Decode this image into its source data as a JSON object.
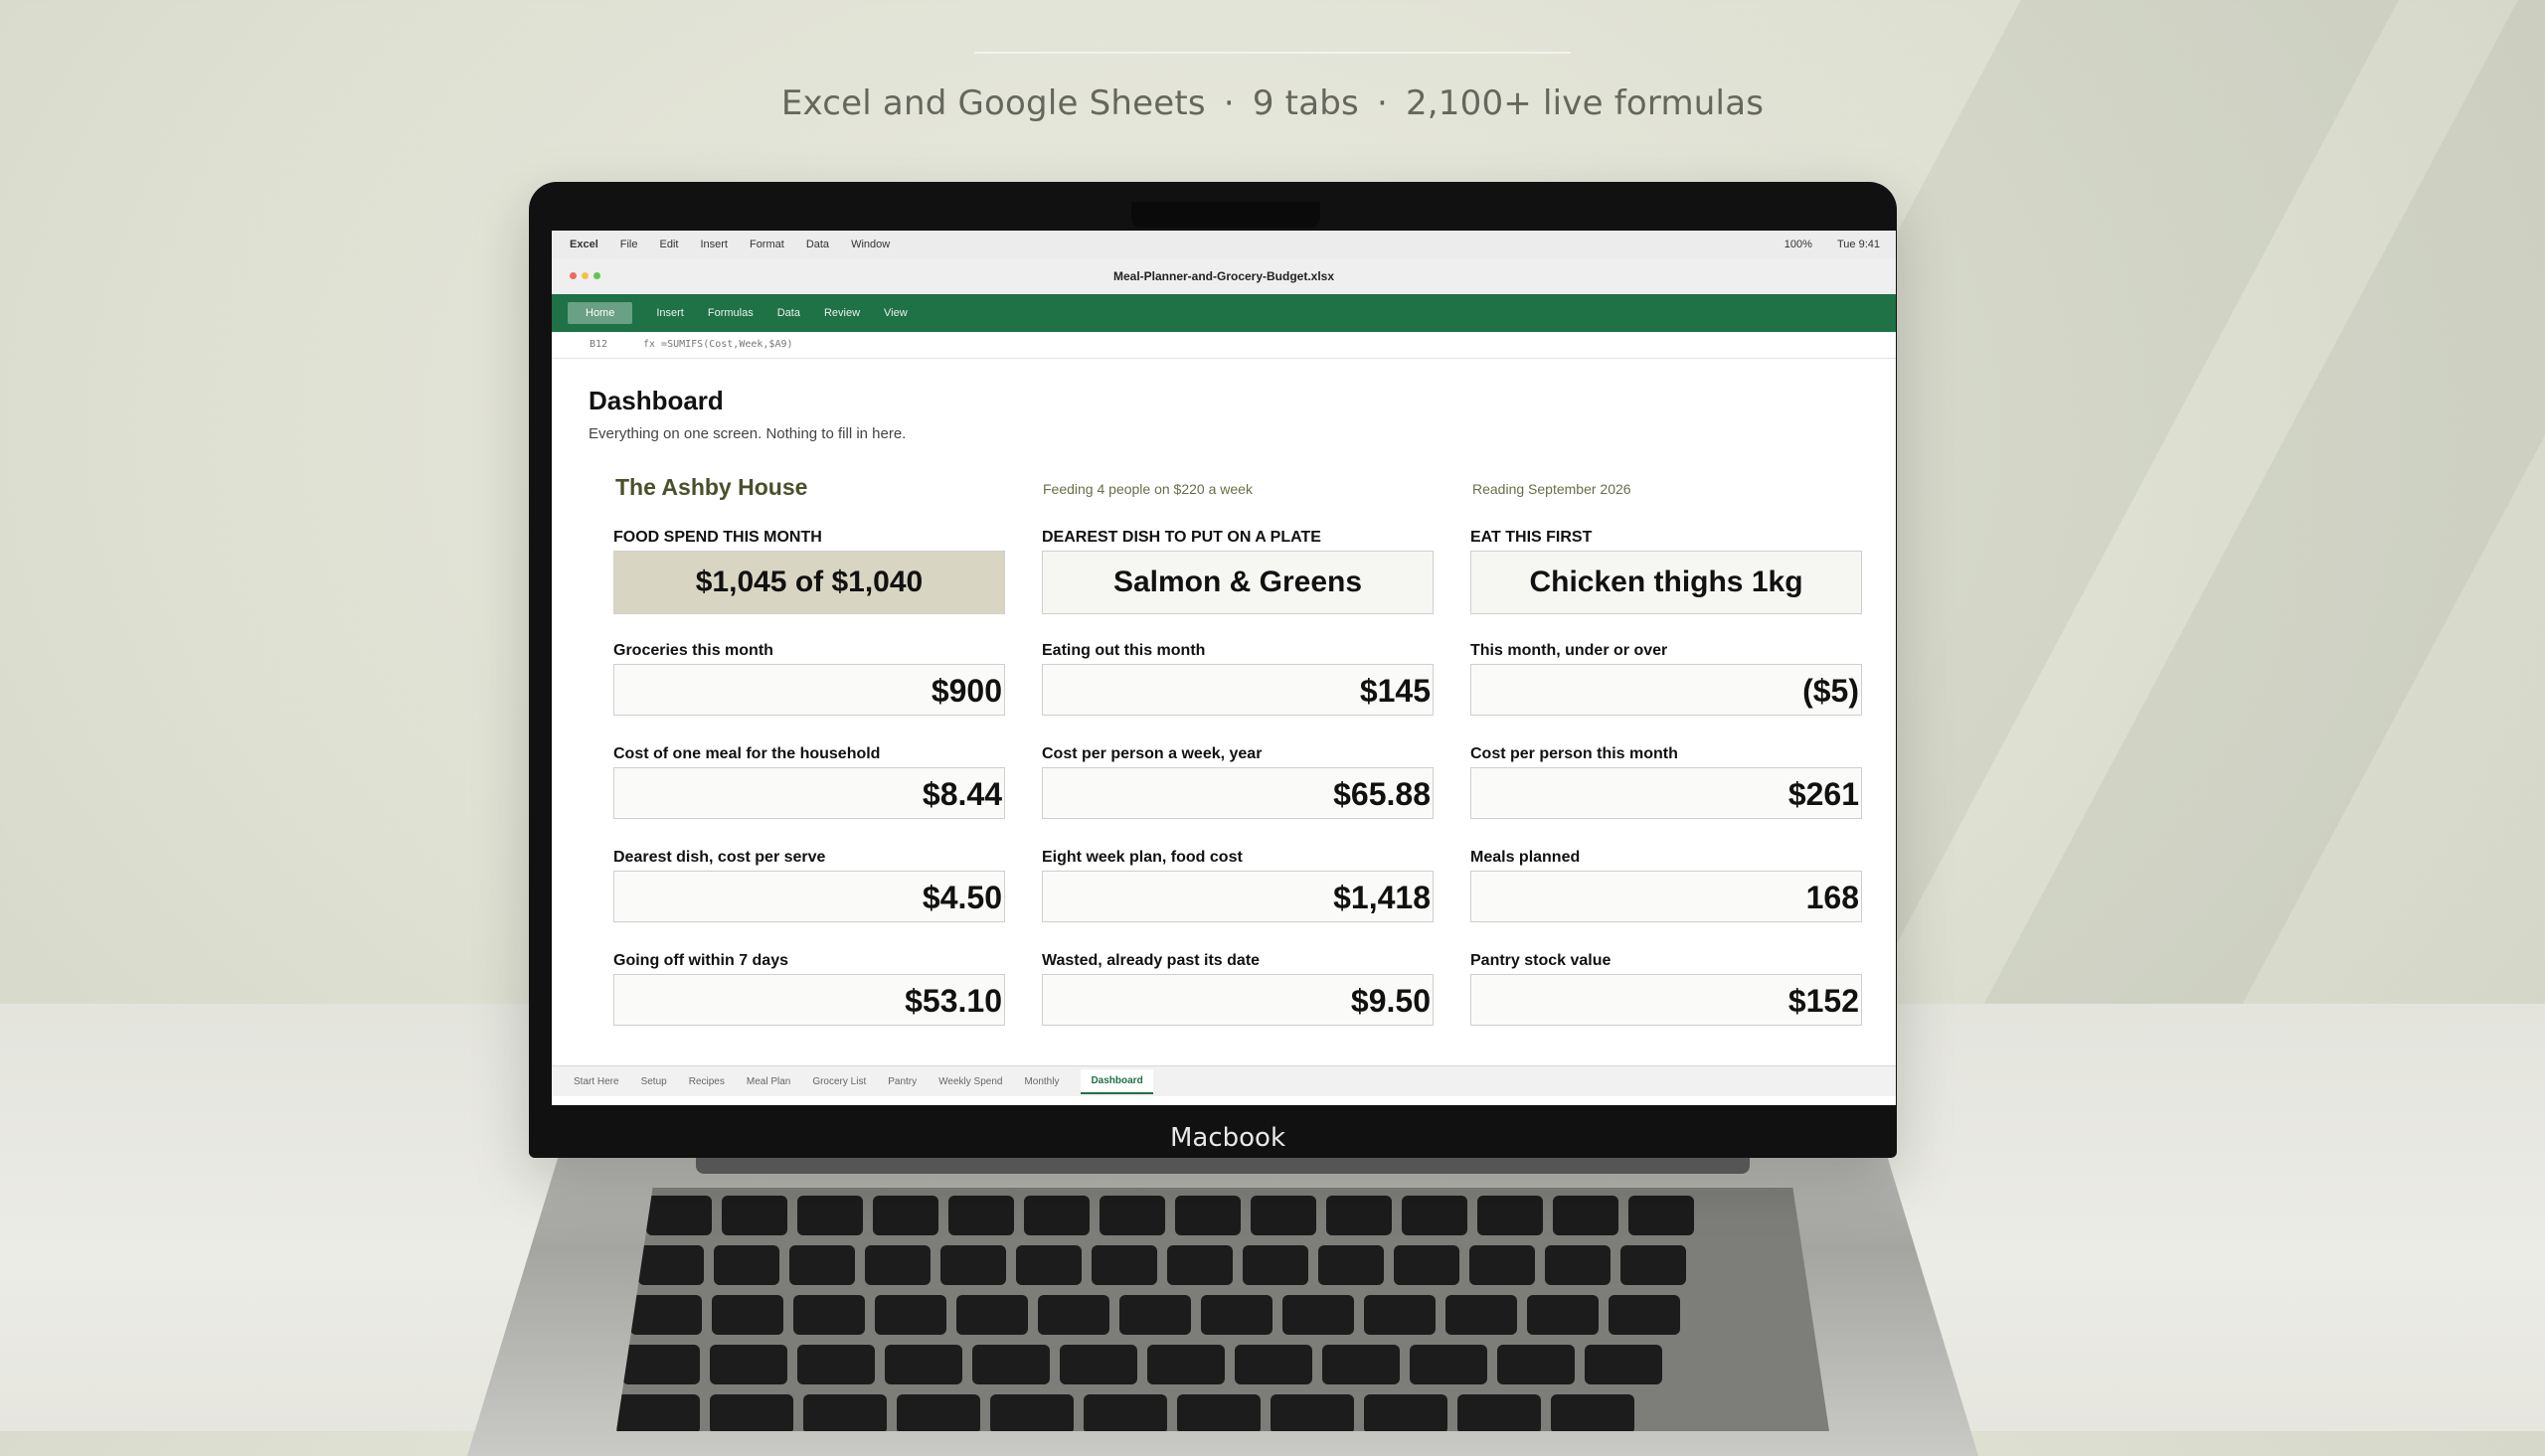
{
  "subtitle": {
    "platforms": "Excel and Google Sheets",
    "tabs": "9 tabs",
    "formulas": "2,100+ live formulas",
    "separator": "·"
  },
  "laptop": {
    "brand": "Macbook"
  },
  "menubar": {
    "app": "Excel",
    "items": [
      "File",
      "Edit",
      "Insert",
      "Format",
      "Data",
      "Window"
    ],
    "zoom": "100%",
    "clock": "Tue 9:41"
  },
  "window": {
    "file_name": "Meal-Planner-and-Grocery-Budget.xlsx",
    "lights": [
      "#ee6a5e",
      "#f5bf4f",
      "#61c554"
    ]
  },
  "ribbon": {
    "active_tab": "Home",
    "tabs": [
      "Insert",
      "Formulas",
      "Data",
      "Review",
      "View"
    ],
    "color": "#1f7146"
  },
  "formula_bar": {
    "cell_ref": "B12",
    "formula": "fx  =SUMIFS(Cost,Week,$A9)"
  },
  "dashboard": {
    "title": "Dashboard",
    "subtitle": "Everything on one screen. Nothing to fill in here.",
    "household": "The Ashby House",
    "feeding": "Feeding 4 people on $220 a week",
    "reading": "Reading September 2026",
    "highlights": [
      {
        "label": "FOOD SPEND THIS MONTH",
        "value": "$1,045 of $1,040"
      },
      {
        "label": "DEAREST DISH TO PUT ON A PLATE",
        "value": "Salmon & Greens"
      },
      {
        "label": "EAT THIS FIRST",
        "value": "Chicken thighs 1kg"
      }
    ],
    "metrics": [
      {
        "label": "Groceries this month",
        "value": "$900"
      },
      {
        "label": "Eating out this month",
        "value": "$145"
      },
      {
        "label": "This month, under or over",
        "value": "($5)"
      },
      {
        "label": "Cost of one meal for the household",
        "value": "$8.44"
      },
      {
        "label": "Cost per person a week, year",
        "value": "$65.88"
      },
      {
        "label": "Cost per person this month",
        "value": "$261"
      },
      {
        "label": "Dearest dish, cost per serve",
        "value": "$4.50"
      },
      {
        "label": "Eight week plan, food cost",
        "value": "$1,418"
      },
      {
        "label": "Meals planned",
        "value": "168"
      },
      {
        "label": "Going off within 7 days",
        "value": "$53.10"
      },
      {
        "label": "Wasted, already past its date",
        "value": "$9.50"
      },
      {
        "label": "Pantry stock value",
        "value": "$152"
      }
    ]
  },
  "sheet_tabs": [
    "Start Here",
    "Setup",
    "Recipes",
    "Meal Plan",
    "Grocery List",
    "Pantry",
    "Weekly Spend",
    "Monthly",
    "Dashboard"
  ],
  "active_sheet": "Dashboard"
}
